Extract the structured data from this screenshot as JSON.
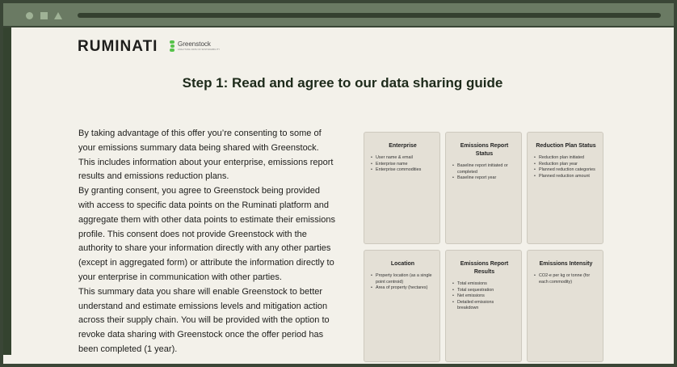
{
  "brand": {
    "ruminati": "RUMINATI",
    "greenstock_name": "Greenstock",
    "greenstock_tagline": "ANALYSING DATA OF SUSTAINABILITY"
  },
  "page": {
    "title": "Step 1: Read and agree to our data sharing guide",
    "paragraphs": [
      "By taking advantage of this offer you’re consenting to some of your emissions summary data being shared with Greenstock. This includes information about your enterprise, emissions report results and emissions reduction plans.",
      "By granting consent, you agree to Greenstock being provided with access to specific data points on the Ruminati platform and aggregate them with other data points to estimate their emissions profile.  This consent does not provide Greenstock with the authority to share your information directly with any other parties (except in aggregated form) or attribute the information directly to your enterprise in communication with other parties.",
      "This summary data you share will enable Greenstock to better understand and estimate emissions levels and mitigation action across their supply chain. You will be provided with the option to revoke data sharing with Greenstock once the offer period has been completed (1 year)."
    ]
  },
  "cards": [
    {
      "title": "Enterprise",
      "items": [
        "User name & email",
        "Enterprise name",
        "Enterprise commodities"
      ]
    },
    {
      "title": "Emissions Report Status",
      "items": [
        "Baseline report initiated or completed",
        "Baseline report year"
      ]
    },
    {
      "title": "Reduction Plan Status",
      "items": [
        "Reduction plan initiated",
        "Reduction plan year",
        "Planned reduction categories",
        "Planned reduction amount"
      ]
    },
    {
      "title": "Location",
      "items": [
        "Property location (as a single point centroid)",
        "Area of property (hectares)"
      ]
    },
    {
      "title": "Emissions Report Results",
      "items": [
        "Total emissions",
        "Total sequestration",
        "Net emissions",
        "Detailed emissions breakdown"
      ]
    },
    {
      "title": "Emissions Intensity",
      "items": [
        "CO2-e per kg or tonne (for each commodity)"
      ]
    }
  ],
  "icons": {
    "window_controls": [
      "circle-control-icon",
      "square-control-icon",
      "triangle-control-icon"
    ],
    "brand_mark": "greenstock-logo-icon"
  },
  "colors": {
    "frame": "#3a4636",
    "titlebar": "#6a7a63",
    "page_background": "#f3f1ea",
    "card_background": "#e4e0d6",
    "greenstock_green": "#56c24a"
  }
}
